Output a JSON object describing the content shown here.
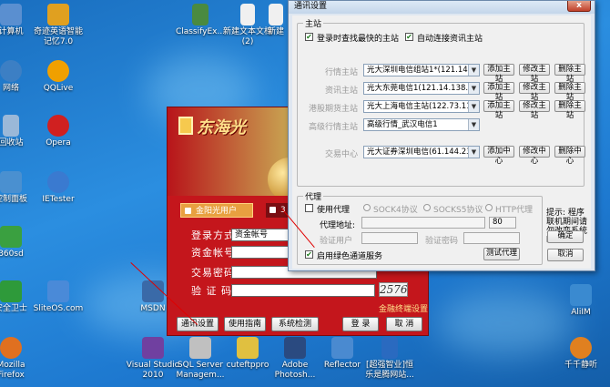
{
  "desktop": {
    "left_icons": [
      {
        "label": "计算机",
        "color": "#5a8fd0"
      },
      {
        "label": "网络",
        "color": "#3c7fc4"
      },
      {
        "label": "回收站",
        "color": "#9ab8d8"
      },
      {
        "label": "控制面板",
        "color": "#4a90d0"
      },
      {
        "label": "360sd",
        "color": "#3aa040"
      },
      {
        "label": "安全卫士",
        "color": "#2e9a3a"
      },
      {
        "label": "Mozilla Firefox",
        "color": "#e07020"
      }
    ],
    "col2_icons": [
      {
        "label": "奇迹英语智能记忆7.0",
        "color": "#e0a020"
      },
      {
        "label": "QQLive",
        "color": "#f0a000"
      },
      {
        "label": "Opera",
        "color": "#d02020"
      },
      {
        "label": "IETester",
        "color": "#3a7ad0"
      },
      {
        "label": "SliteOS.com",
        "color": "#4a8ad8"
      },
      {
        "label": "Visual Studio 2010",
        "color": "#7040a0"
      }
    ],
    "top_icons": [
      {
        "label": "ClassifyEx...",
        "color": "#4a8a40"
      },
      {
        "label": "新建文本文档 (2)",
        "color": "#f0f0f0"
      },
      {
        "label": "新建",
        "color": "#f0f0f0"
      }
    ],
    "bottom_icons": [
      {
        "label": "MSDN",
        "color": "#3a6aa8"
      },
      {
        "label": "SQL Server Managem...",
        "color": "#c0c0c0"
      },
      {
        "label": "cuteftppro",
        "color": "#e0c040"
      },
      {
        "label": "Adobe Photosh...",
        "color": "#2a4a80"
      },
      {
        "label": "Reflector",
        "color": "#4a8ad0"
      },
      {
        "label": "[超强智业]恒乐是腾网站...",
        "color": "#2a6ac0"
      }
    ],
    "right_icons": [
      {
        "label": "AliIM",
        "color": "#3a8ad0"
      },
      {
        "label": "千千静听",
        "color": "#e08020"
      }
    ]
  },
  "login": {
    "brand": "东海光",
    "tabs": [
      "金阳光用户",
      "3"
    ],
    "login_method_label": "登录方式",
    "login_method_value": "资金帐号",
    "account_label": "资金帐号",
    "password_label": "交易密码",
    "captcha_label": "验 证 码",
    "captcha_value": "2576",
    "terminal_settings_link": "金融终端设置",
    "buttons": {
      "comm_settings": "通讯设置",
      "guide": "使用指南",
      "system_check": "系统检测",
      "login": "登 录",
      "cancel": "取 消"
    }
  },
  "comm_dialog": {
    "title": "通讯设置",
    "close": "x",
    "main_group_title": "主站",
    "fastest_checkbox": "登录时查找最快的主站",
    "auto_connect_checkbox": "自动连接资讯主站",
    "rows": [
      {
        "label": "行情主站",
        "value": "光大深圳电信组站1*(121.14.1(",
        "add": "添加主站",
        "edit": "修改主站",
        "delete": "删除主站",
        "has_buttons": true
      },
      {
        "label": "资讯主站",
        "value": "光大东莞电信1(121.14.138.75)",
        "add": "添加主站",
        "edit": "修改主站",
        "delete": "删除主站",
        "has_buttons": true
      },
      {
        "label": "港股期货主站",
        "value": "光大上海电信主站(122.73.111",
        "add": "添加主站",
        "edit": "修改主站",
        "delete": "删除主站",
        "has_buttons": true
      },
      {
        "label": "高级行情主站",
        "value": "高级行情_武汉电信1",
        "has_buttons": false
      },
      {
        "label": "交易中心",
        "value": "光大证券深圳电信(61.144.230",
        "add": "添加中心",
        "edit": "修改中心",
        "delete": "删除中心",
        "has_buttons": true
      }
    ],
    "proxy": {
      "group_title": "代理",
      "use_proxy": "使用代理",
      "socks4": "SOCK4协议",
      "socks5": "SOCKS5协议",
      "http": "HTTP代理",
      "address_label": "代理地址:",
      "port_value": "80",
      "user_label": "验证用户",
      "password_label": "验证密码",
      "green_channel": "启用绿色通道服务",
      "test_button": "测试代理"
    },
    "hint": "提示: 程序联机期间请勿改变系统时间。",
    "ok": "确定",
    "cancel": "取消"
  }
}
